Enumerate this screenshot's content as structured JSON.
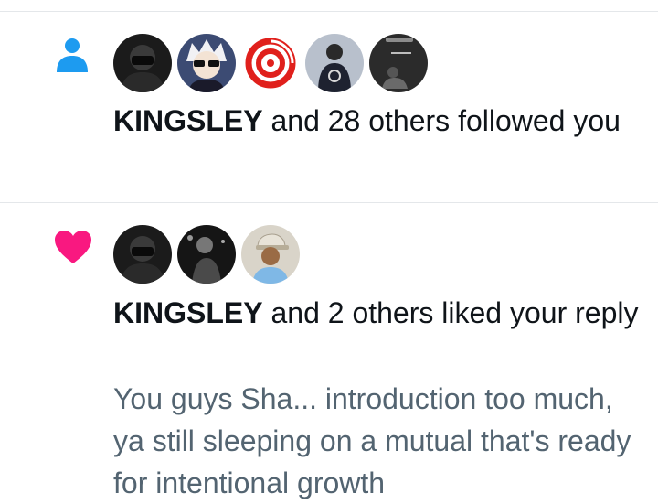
{
  "notifications": [
    {
      "type_icon": "person-icon",
      "icon_color": "#1d9bf0",
      "avatars": [
        "avatar-dark-masked",
        "avatar-anime-sunglasses",
        "avatar-red-swirl",
        "avatar-person-dark-hoodie",
        "avatar-dark-scene"
      ],
      "name": "KINGSLEY",
      "action_text": " and 28 others followed you"
    },
    {
      "type_icon": "heart-icon",
      "icon_color": "#f91880",
      "avatars": [
        "avatar-dark-masked",
        "avatar-dark-photo",
        "avatar-cap-person"
      ],
      "name": "KINGSLEY",
      "action_text": " and 2 others liked your reply",
      "quoted_text": "You guys Sha... introduction too much, ya still sleeping on a mutual that's ready for intentional growth"
    }
  ]
}
